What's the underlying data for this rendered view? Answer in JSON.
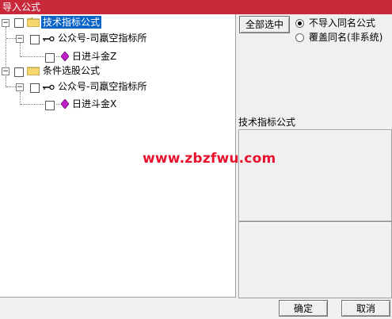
{
  "window": {
    "title": "导入公式"
  },
  "tree": {
    "groups": [
      {
        "label": "技术指标公式",
        "selected": true,
        "children": [
          {
            "label": "公众号-司羸空指标所",
            "children": [
              {
                "label": "日进斗金Z"
              }
            ]
          }
        ]
      },
      {
        "label": "条件选股公式",
        "selected": false,
        "children": [
          {
            "label": "公众号-司羸空指标所",
            "children": [
              {
                "label": "日进斗金X"
              }
            ]
          }
        ]
      }
    ]
  },
  "options": {
    "select_all_label": "全部选中",
    "radio_skip_label": "不导入同名公式",
    "radio_overwrite_label": "覆盖同名(非系统)",
    "selected_option": "skip"
  },
  "description": {
    "title": "技术指标公式"
  },
  "footer": {
    "ok_label": "确定",
    "cancel_label": "取消"
  },
  "watermark": "www.zbzfwu.com",
  "colors": {
    "titlebar": "#c8283a",
    "selection": "#0a64c8",
    "watermark": "#e8122e",
    "folder": "#f5d76e",
    "gem": "#c01ec8"
  }
}
